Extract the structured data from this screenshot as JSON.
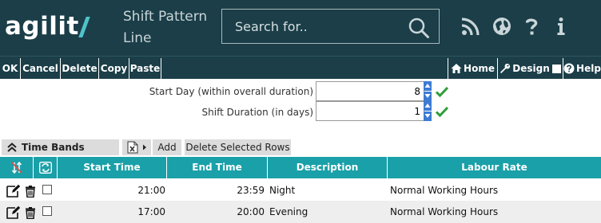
{
  "header": {
    "logo_text": "agilit",
    "title": "Shift Pattern Line",
    "search": {
      "placeholder": "Search for.."
    },
    "icons": [
      "rss-icon",
      "globe-icon",
      "help-icon",
      "info-icon"
    ]
  },
  "toolbar": {
    "ok": "OK",
    "cancel": "Cancel",
    "delete": "Delete",
    "copy": "Copy",
    "paste": "Paste",
    "home": "Home",
    "design": "Design",
    "help": "Help"
  },
  "form": {
    "start_day_label": "Start Day (within overall duration)",
    "start_day_value": "8",
    "duration_label": "Shift Duration (in days)",
    "duration_value": "1"
  },
  "time_bands": {
    "title": "Time Bands",
    "add_label": "Add",
    "delete_selected_label": "Delete Selected Rows",
    "columns": [
      "Start Time",
      "End Time",
      "Description",
      "Labour Rate"
    ],
    "rows": [
      {
        "start": "21:00",
        "end": "23:59",
        "description": "Night",
        "rate": "Normal Working Hours"
      },
      {
        "start": "17:00",
        "end": "20:00",
        "description": "Evening",
        "rate": "Normal Working Hours"
      }
    ]
  },
  "colors": {
    "header_bg": "#1b3e48",
    "table_header_bg": "#1aa0a8",
    "accent_check": "#2e9e3a",
    "spinner": "#3d7bd4"
  }
}
